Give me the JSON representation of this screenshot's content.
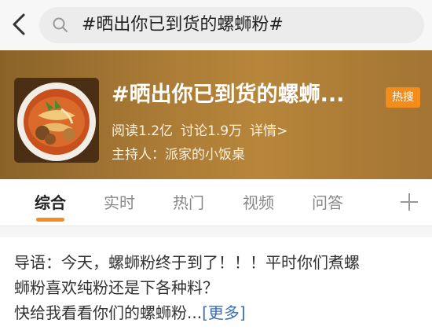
{
  "search": {
    "query": "#晒出你已到货的螺蛳粉#"
  },
  "topic": {
    "title": "#晒出你已到货的螺蛳...",
    "badge": "热搜",
    "reads": "阅读1.2亿",
    "discussions": "讨论1.9万",
    "details": "详情>",
    "host": "主持人：派家的小饭桌"
  },
  "tabs": [
    "综合",
    "实时",
    "热门",
    "视频",
    "问答"
  ],
  "intro": {
    "line1": "导语：今天，螺蛳粉终于到了！！！平时你们煮螺",
    "line2": "蛳粉喜欢纯粉还是下各种料？",
    "line3": "快给我看看你们的螺蛳粉...",
    "more": "[更多]"
  },
  "icons": {
    "back": "chevron-left-icon",
    "search": "search-icon",
    "plus": "plus-icon"
  },
  "colors": {
    "accent": "#f28c1a",
    "header_bg": "#a97a35",
    "link": "#3b6fb6"
  }
}
